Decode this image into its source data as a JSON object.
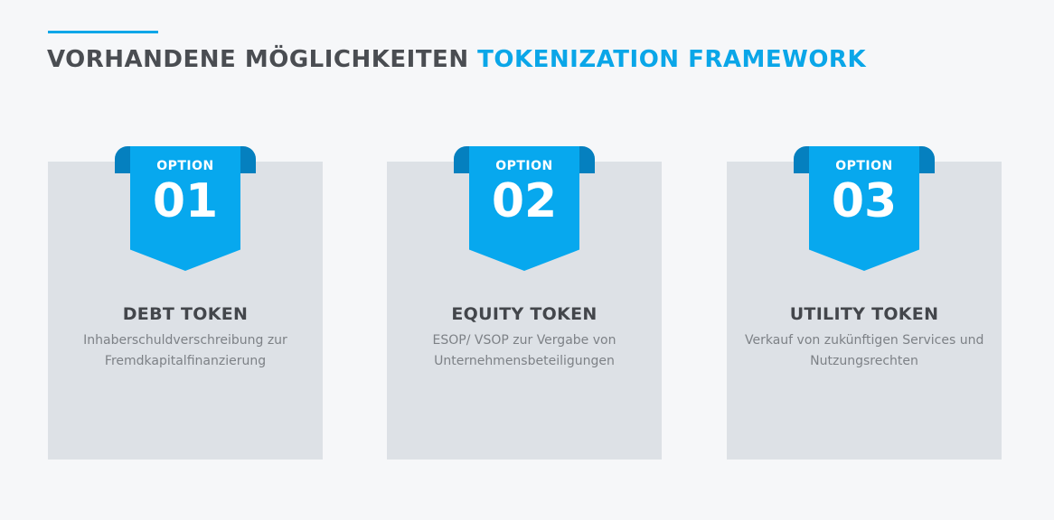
{
  "header": {
    "title_part1": "VORHANDENE MÖGLICHKEITEN",
    "title_part2": "TOKENIZATION FRAMEWORK",
    "accent_color": "#0aa6e8"
  },
  "options": [
    {
      "label": "OPTION",
      "number": "01",
      "title": "DEBT TOKEN",
      "description_line1": "Inhaberschuldverschreibung zur",
      "description_line2": "Fremdkapitalfinanzierung"
    },
    {
      "label": "OPTION",
      "number": "02",
      "title": "EQUITY TOKEN",
      "description_line1": "ESOP/ VSOP zur Vergabe von",
      "description_line2": "Unternehmensbeteiligungen"
    },
    {
      "label": "OPTION",
      "number": "03",
      "title": "UTILITY TOKEN",
      "description_line1": "Verkauf von zukünftigen Services und",
      "description_line2": "Nutzungsrechten"
    }
  ]
}
